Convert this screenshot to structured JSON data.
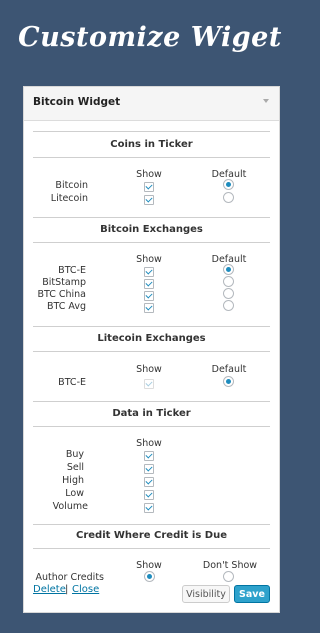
{
  "page_heading": "Customize Wiget",
  "widget": {
    "title": "Bitcoin Widget",
    "coins_in_ticker": {
      "title": "Coins in Ticker",
      "show_header": "Show",
      "default_header": "Default",
      "rows": [
        {
          "label": "Bitcoin",
          "show": true,
          "default": true
        },
        {
          "label": "Litecoin",
          "show": true,
          "default": false
        }
      ]
    },
    "bitcoin_exchanges": {
      "title": "Bitcoin Exchanges",
      "show_header": "Show",
      "default_header": "Default",
      "rows": [
        {
          "label": "BTC-E",
          "show": true,
          "default": true
        },
        {
          "label": "BitStamp",
          "show": true,
          "default": false
        },
        {
          "label": "BTC China",
          "show": true,
          "default": false
        },
        {
          "label": "BTC Avg",
          "show": true,
          "default": false
        }
      ]
    },
    "litecoin_exchanges": {
      "title": "Litecoin Exchanges",
      "show_header": "Show",
      "default_header": "Default",
      "rows": [
        {
          "label": "BTC-E",
          "show": true,
          "show_disabled": true,
          "default": true
        }
      ]
    },
    "data_in_ticker": {
      "title": "Data in Ticker",
      "show_header": "Show",
      "rows": [
        {
          "label": "Buy",
          "show": true
        },
        {
          "label": "Sell",
          "show": true
        },
        {
          "label": "High",
          "show": true
        },
        {
          "label": "Low",
          "show": true
        },
        {
          "label": "Volume",
          "show": true
        }
      ]
    },
    "credit": {
      "title": "Credit Where Credit is Due",
      "show_header": "Show",
      "dont_show_header": "Don't Show",
      "row_label": "Author Credits",
      "show_selected": true
    },
    "footer": {
      "delete_label": "Delete",
      "separator": "|",
      "close_label": "Close",
      "visibility_label": "Visibility",
      "save_label": "Save"
    }
  }
}
